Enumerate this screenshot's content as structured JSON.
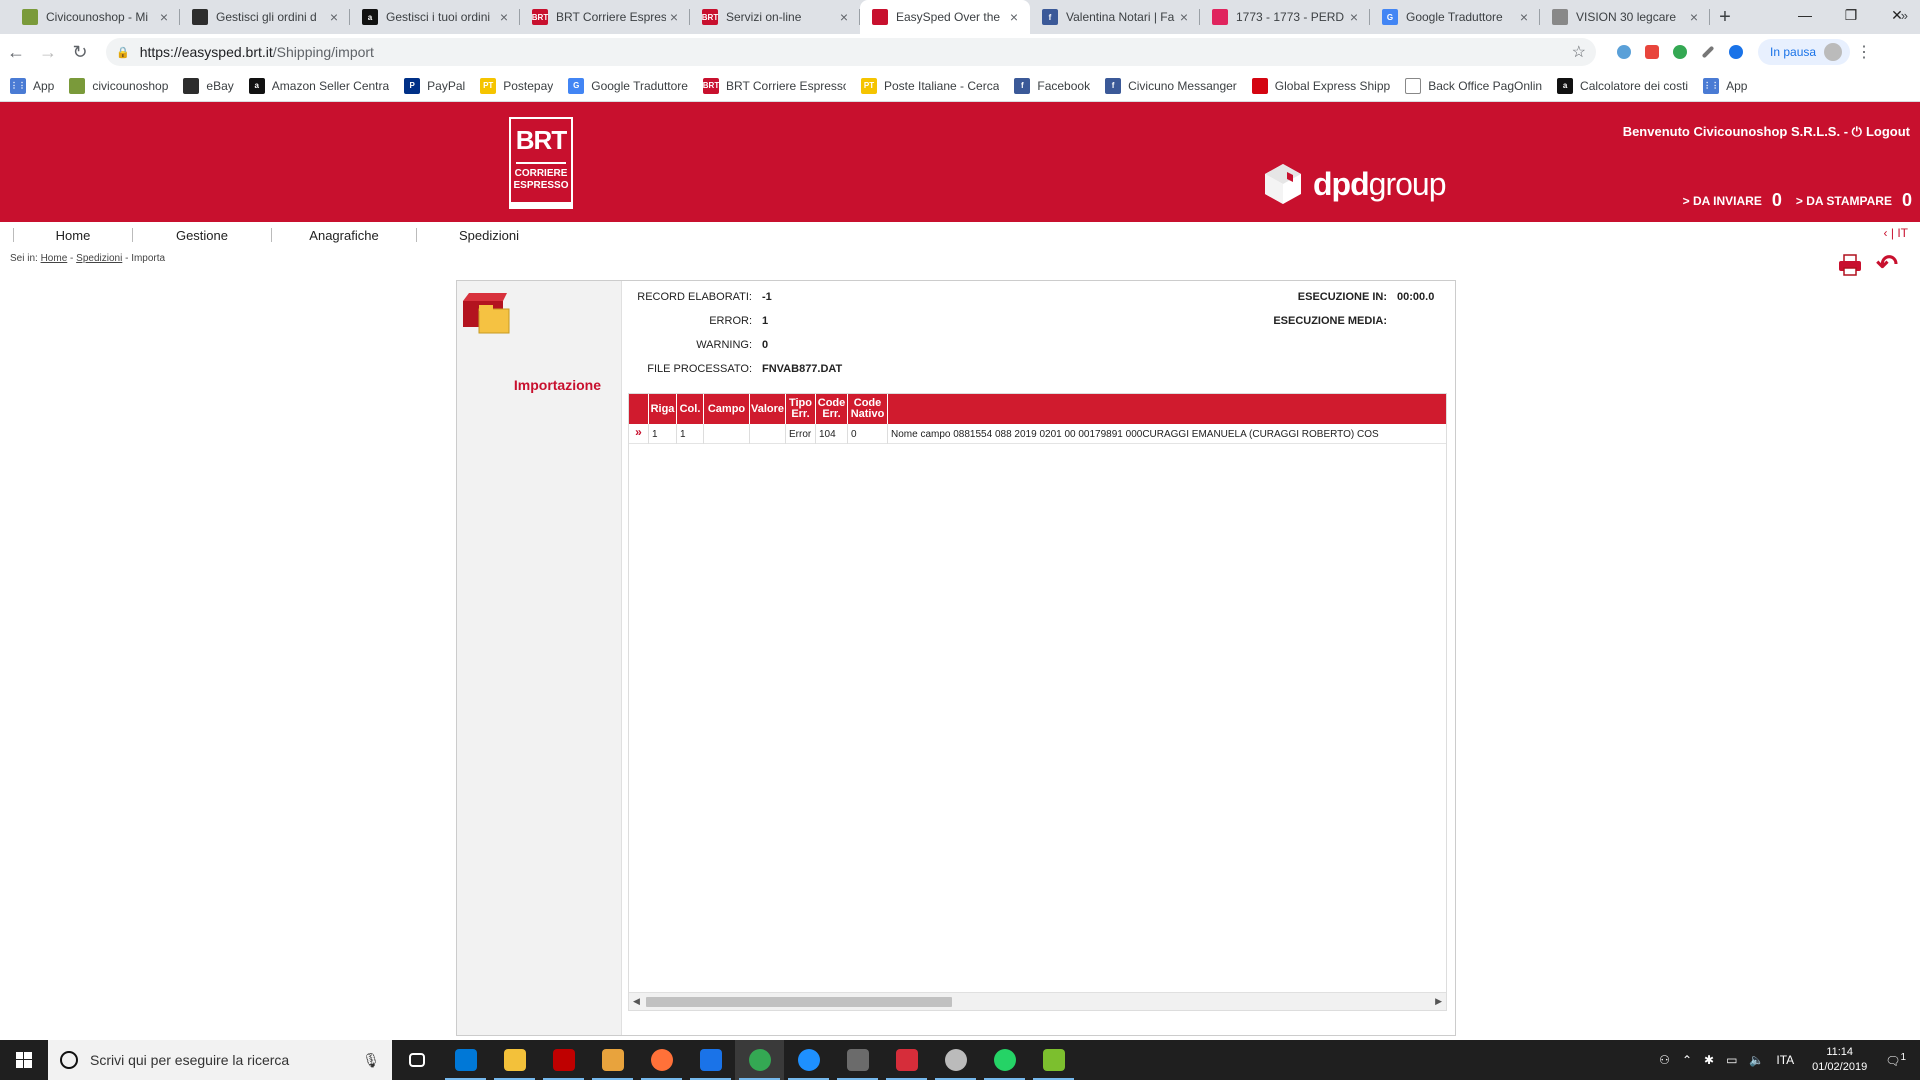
{
  "browser": {
    "tabs": [
      {
        "title": "Civicounoshop - Mi",
        "fav_color": "#7a9a3a",
        "fav_text": ""
      },
      {
        "title": "Gestisci gli ordini d",
        "fav_color": "#2d2d2d",
        "fav_text": ""
      },
      {
        "title": "Gestisci i tuoi ordini",
        "fav_color": "#111111",
        "fav_text": "a"
      },
      {
        "title": "BRT Corriere Espres",
        "fav_color": "#c8102e",
        "fav_text": "BRT"
      },
      {
        "title": "Servizi on-line",
        "fav_color": "#c8102e",
        "fav_text": "BRT"
      },
      {
        "title": "EasySped Over the",
        "fav_color": "#c8102e",
        "fav_text": ""
      },
      {
        "title": "Valentina Notari | Fa",
        "fav_color": "#3b5998",
        "fav_text": "f"
      },
      {
        "title": "1773 - 1773 - PERD",
        "fav_color": "#e0245e",
        "fav_text": ""
      },
      {
        "title": "Google Traduttore",
        "fav_color": "#4285f4",
        "fav_text": "G"
      },
      {
        "title": "VISION 30 legcare",
        "fav_color": "#888888",
        "fav_text": ""
      }
    ],
    "active_tab_index": 5,
    "new_tab": "+",
    "window_controls": {
      "minimize": "—",
      "restore": "❐",
      "close": "✕"
    },
    "url_host": "https://easysped.brt.it",
    "url_path": "/Shipping/import",
    "profile_label": "In pausa",
    "bookmarks": [
      {
        "label": "App",
        "fav_color": "#4a7bd4",
        "fav_text": "⋮⋮"
      },
      {
        "label": "civicounoshop",
        "fav_color": "#7a9a3a",
        "fav_text": ""
      },
      {
        "label": "eBay",
        "fav_color": "#2d2d2d",
        "fav_text": ""
      },
      {
        "label": "Amazon Seller Centra",
        "fav_color": "#111111",
        "fav_text": "a"
      },
      {
        "label": "PayPal",
        "fav_color": "#003087",
        "fav_text": "P"
      },
      {
        "label": "Postepay",
        "fav_color": "#f5c400",
        "fav_text": "PT"
      },
      {
        "label": "Google Traduttore",
        "fav_color": "#4285f4",
        "fav_text": "G"
      },
      {
        "label": "BRT Corriere Espresso",
        "fav_color": "#c8102e",
        "fav_text": "BRT"
      },
      {
        "label": "Poste Italiane - Cerca",
        "fav_color": "#f5c400",
        "fav_text": "PT"
      },
      {
        "label": "Facebook",
        "fav_color": "#3b5998",
        "fav_text": "f"
      },
      {
        "label": "Civicuno Messanger",
        "fav_color": "#3b5998",
        "fav_text": "f"
      },
      {
        "label": "Global Express Shipp",
        "fav_color": "#d40511",
        "fav_text": ""
      },
      {
        "label": "Back Office PagOnlin",
        "fav_color": "#ffffff",
        "fav_text": ""
      },
      {
        "label": "Calcolatore dei costi",
        "fav_color": "#111111",
        "fav_text": "a"
      },
      {
        "label": "App",
        "fav_color": "#4a7bd4",
        "fav_text": "⋮⋮"
      }
    ],
    "bookmarks_more": "»"
  },
  "header": {
    "brt_logo_big": "BRT",
    "brt_logo_small_1": "CORRIERE",
    "brt_logo_small_2": "ESPRESSO",
    "dpd_word_1": "dpd",
    "dpd_word_2": "group",
    "welcome": "Benvenuto Civicounoshop S.R.L.S. -",
    "logout": "Logout",
    "da_inviare_label": "DA INVIARE",
    "da_inviare_count": "0",
    "da_stampare_label": "DA STAMPARE",
    "da_stampare_count": "0",
    "brand_color": "#c8102e"
  },
  "menu": {
    "items": [
      "Home",
      "Gestione",
      "Anagrafiche",
      "Spedizioni"
    ],
    "lang": "IT"
  },
  "breadcrumb": {
    "prefix": "Sei in:",
    "home": "Home",
    "spedizioni": "Spedizioni",
    "current": "- Importa"
  },
  "import": {
    "title": "Importazione",
    "record_label": "RECORD ELABORATI:",
    "record_value": "-1",
    "error_label": "ERROR:",
    "error_value": "1",
    "warning_label": "WARNING:",
    "warning_value": "0",
    "file_label": "FILE PROCESSATO:",
    "file_value": "FNVAB877.DAT",
    "exec_label": "ESECUZIONE IN:",
    "exec_value": "00:00.0",
    "exec_avg_label": "ESECUZIONE MEDIA:",
    "exec_avg_value": ""
  },
  "grid": {
    "columns": [
      {
        "label": "",
        "w": 20
      },
      {
        "label": "Riga",
        "w": 28
      },
      {
        "label": "Col.",
        "w": 27
      },
      {
        "label": "Campo",
        "w": 46
      },
      {
        "label": "Valore",
        "w": 36
      },
      {
        "label": "Tipo Err.",
        "w": 30
      },
      {
        "label": "Code Err.",
        "w": 32
      },
      {
        "label": "Code Nativo",
        "w": 40
      },
      {
        "label": "",
        "w": 560
      }
    ],
    "rows": [
      [
        "»",
        "1",
        "1",
        "",
        "",
        "Error",
        "104",
        "0",
        "Nome campo 0881554 088 2019 0201 00 00179891 000CURAGGI EMANUELA (CURAGGI ROBERTO) COS"
      ]
    ],
    "scroll_left": "◀",
    "scroll_right": "▶"
  },
  "taskbar": {
    "search_placeholder": "Scrivi qui per eseguire la ricerca",
    "apps": [
      {
        "name": "task-view",
        "color": "#ffffff"
      },
      {
        "name": "store",
        "color": "#0078d7"
      },
      {
        "name": "file-explorer",
        "color": "#f3c13a"
      },
      {
        "name": "filezilla",
        "color": "#bf0000"
      },
      {
        "name": "media",
        "color": "#e8a33d"
      },
      {
        "name": "firefox",
        "color": "#ff7139"
      },
      {
        "name": "thunderbird",
        "color": "#1a73e8"
      },
      {
        "name": "chrome",
        "color": "#34a853"
      },
      {
        "name": "edge",
        "color": "#1e90ff"
      },
      {
        "name": "app-game",
        "color": "#6b6b6b"
      },
      {
        "name": "app-strawberry",
        "color": "#d62d3a"
      },
      {
        "name": "app-pinwheel",
        "color": "#bbbbbb"
      },
      {
        "name": "whatsapp",
        "color": "#25d366"
      },
      {
        "name": "app-green",
        "color": "#7cbf2e"
      }
    ],
    "active_app_index": 7,
    "language": "ITA",
    "time": "11:14",
    "date": "01/02/2019",
    "notifications": "1"
  }
}
